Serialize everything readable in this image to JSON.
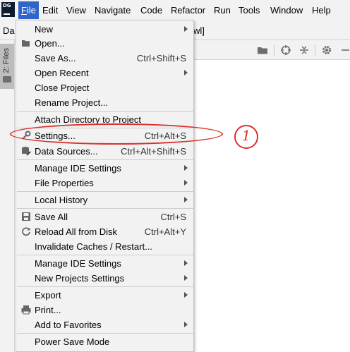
{
  "app_logo": "DG",
  "menubar": {
    "items": [
      {
        "label": "File",
        "mn": "F",
        "rest": "ile",
        "active": true
      },
      {
        "label": "Edit"
      },
      {
        "label": "View"
      },
      {
        "label": "Navigate"
      },
      {
        "label": "Code"
      },
      {
        "label": "Refactor"
      },
      {
        "label": "Run"
      },
      {
        "label": "Tools"
      },
      {
        "label": "Window"
      },
      {
        "label": "Help"
      }
    ]
  },
  "toolbar": {
    "breadcrumb_left": "Da",
    "breadcrumb_right": "wl]"
  },
  "left_stripe": {
    "files_tab": "2: Files"
  },
  "file_menu": {
    "new": "New",
    "open": "Open...",
    "save_as": "Save As...",
    "save_as_shortcut": "Ctrl+Shift+S",
    "open_recent": "Open Recent",
    "close_project": "Close Project",
    "rename_project": "Rename Project...",
    "attach_directory": "Attach Directory to Project",
    "settings": "Settings...",
    "settings_shortcut": "Ctrl+Alt+S",
    "data_sources": "Data Sources...",
    "data_sources_shortcut": "Ctrl+Alt+Shift+S",
    "manage_ide_settings": "Manage IDE Settings",
    "file_properties": "File Properties",
    "local_history": "Local History",
    "save_all": "Save All",
    "save_all_shortcut": "Ctrl+S",
    "reload_all": "Reload All from Disk",
    "reload_all_shortcut": "Ctrl+Alt+Y",
    "invalidate_caches": "Invalidate Caches / Restart...",
    "manage_ide_settings_2": "Manage IDE Settings",
    "new_projects_settings": "New Projects Settings",
    "export": "Export",
    "print": "Print...",
    "add_to_favorites": "Add to Favorites",
    "power_save_mode": "Power Save Mode"
  },
  "annotation": {
    "number": "1",
    "color": "#d9312b"
  },
  "colors": {
    "menu_active": "#2f65ca",
    "menu_bg": "#f2f2f2"
  }
}
